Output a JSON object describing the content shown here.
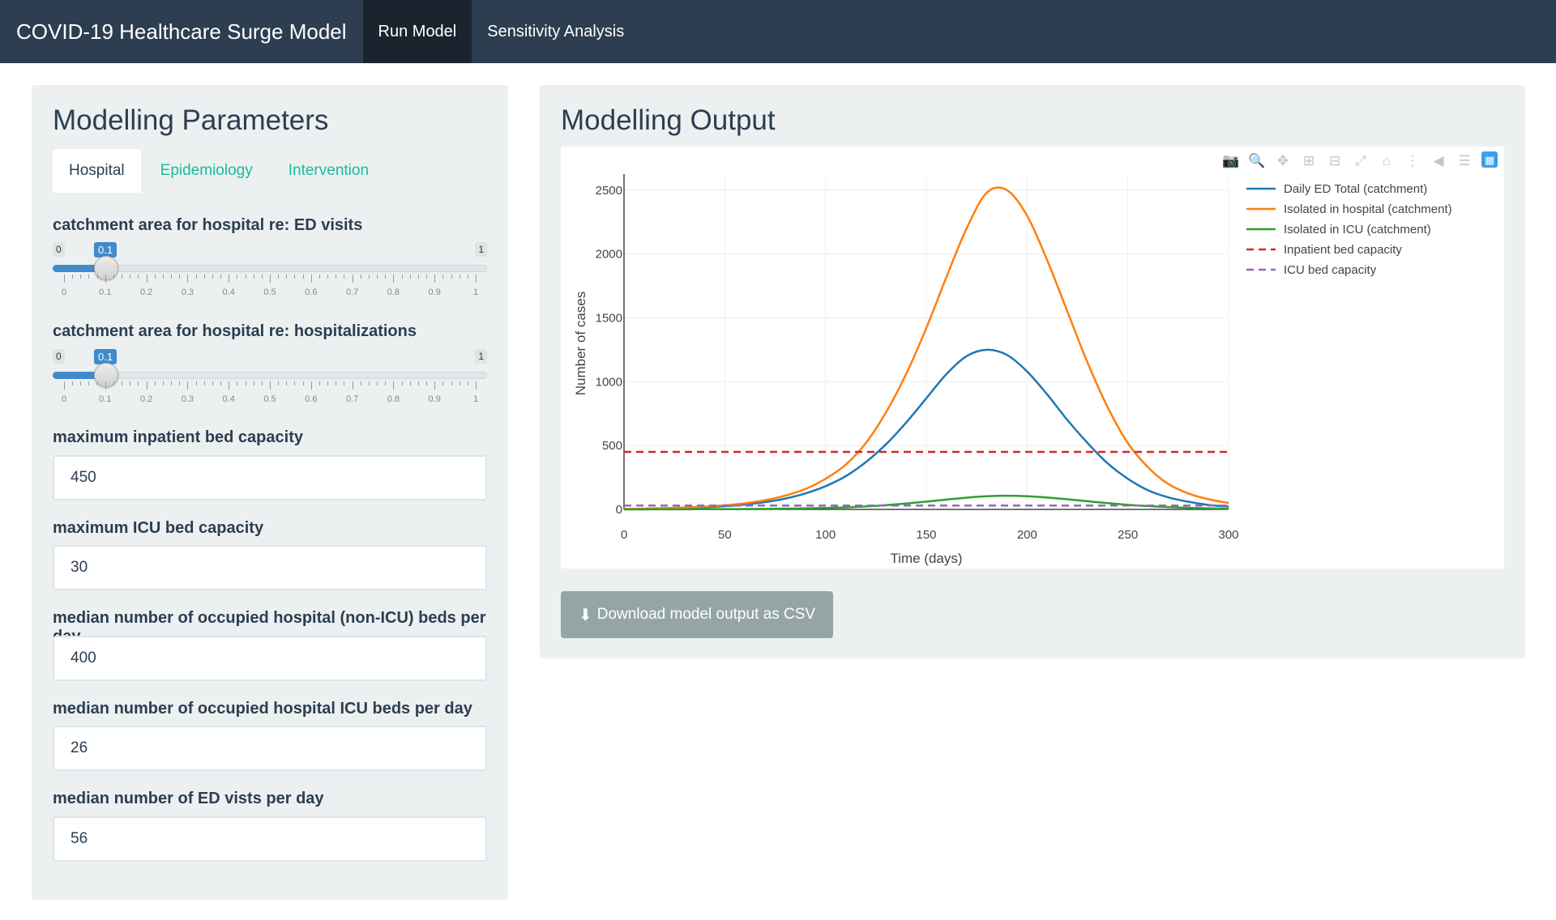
{
  "navbar": {
    "brand": "COVID-19 Healthcare Surge Model",
    "items": [
      {
        "label": "Run Model",
        "active": true
      },
      {
        "label": "Sensitivity Analysis",
        "active": false
      }
    ]
  },
  "params": {
    "title": "Modelling Parameters",
    "tabs": [
      {
        "label": "Hospital",
        "active": true
      },
      {
        "label": "Epidemiology",
        "active": false
      },
      {
        "label": "Intervention",
        "active": false
      }
    ],
    "slider1": {
      "label": "catchment area for hospital re: ED visits",
      "min": "0",
      "max": "1",
      "value": "0.1",
      "tick_labels": [
        "0",
        "0.1",
        "0.2",
        "0.3",
        "0.4",
        "0.5",
        "0.6",
        "0.7",
        "0.8",
        "0.9",
        "1"
      ]
    },
    "slider2": {
      "label": "catchment area for hospital re: hospitalizations",
      "min": "0",
      "max": "1",
      "value": "0.1",
      "tick_labels": [
        "0",
        "0.1",
        "0.2",
        "0.3",
        "0.4",
        "0.5",
        "0.6",
        "0.7",
        "0.8",
        "0.9",
        "1"
      ]
    },
    "inputs": [
      {
        "label": "maximum inpatient bed capacity",
        "value": "450"
      },
      {
        "label": "maximum ICU bed capacity",
        "value": "30"
      },
      {
        "label": "median number of occupied hospital (non-ICU) beds per day",
        "value": "400"
      },
      {
        "label": "median number of occupied hospital ICU beds per day",
        "value": "26"
      },
      {
        "label": "median number of ED vists per day",
        "value": "56"
      }
    ]
  },
  "output": {
    "title": "Modelling Output",
    "download_label": "Download model output as CSV",
    "modebar_icons": [
      "camera-icon",
      "zoom-icon",
      "pan-icon",
      "zoom-in-icon",
      "zoom-out-icon",
      "autoscale-icon",
      "reset-axes-icon",
      "spike-lines-icon",
      "hover-closest-icon",
      "hover-compare-icon",
      "plotly-logo-icon"
    ]
  },
  "chart_data": {
    "type": "line",
    "xlabel": "Time (days)",
    "ylabel": "Number of cases",
    "xlim": [
      0,
      300
    ],
    "ylim": [
      0,
      2600
    ],
    "xticks": [
      0,
      50,
      100,
      150,
      200,
      250,
      300
    ],
    "yticks": [
      0,
      500,
      1000,
      1500,
      2000,
      2500
    ],
    "grid": true,
    "legend_position": "top-right outside",
    "x": [
      0,
      10,
      20,
      30,
      40,
      50,
      60,
      70,
      80,
      90,
      100,
      110,
      120,
      130,
      140,
      150,
      160,
      170,
      180,
      190,
      200,
      210,
      220,
      230,
      240,
      250,
      260,
      270,
      280,
      290,
      300
    ],
    "series": [
      {
        "name": "Daily ED Total (catchment)",
        "color": "#1f77b4",
        "dash": "solid",
        "values": [
          2,
          4,
          7,
          11,
          17,
          25,
          38,
          57,
          85,
          125,
          182,
          260,
          370,
          510,
          680,
          870,
          1060,
          1200,
          1250,
          1210,
          1080,
          900,
          700,
          520,
          360,
          240,
          150,
          95,
          60,
          35,
          22
        ]
      },
      {
        "name": "Isolated in hospital (catchment)",
        "color": "#ff7f0e",
        "dash": "solid",
        "values": [
          3,
          6,
          10,
          15,
          22,
          32,
          48,
          72,
          108,
          160,
          240,
          350,
          520,
          760,
          1060,
          1420,
          1820,
          2200,
          2480,
          2500,
          2300,
          1950,
          1550,
          1150,
          800,
          520,
          330,
          200,
          125,
          80,
          50
        ]
      },
      {
        "name": "Isolated in ICU (catchment)",
        "color": "#2ca02c",
        "dash": "solid",
        "values": [
          0,
          0,
          1,
          1,
          2,
          2,
          3,
          4,
          6,
          8,
          11,
          16,
          23,
          33,
          46,
          61,
          77,
          92,
          103,
          107,
          103,
          93,
          79,
          64,
          49,
          36,
          26,
          18,
          12,
          8,
          5
        ]
      },
      {
        "name": "Inpatient bed capacity",
        "color": "#d62728",
        "dash": "dash",
        "values": [
          450,
          450,
          450,
          450,
          450,
          450,
          450,
          450,
          450,
          450,
          450,
          450,
          450,
          450,
          450,
          450,
          450,
          450,
          450,
          450,
          450,
          450,
          450,
          450,
          450,
          450,
          450,
          450,
          450,
          450,
          450
        ]
      },
      {
        "name": "ICU bed capacity",
        "color": "#9467bd",
        "dash": "dash",
        "values": [
          30,
          30,
          30,
          30,
          30,
          30,
          30,
          30,
          30,
          30,
          30,
          30,
          30,
          30,
          30,
          30,
          30,
          30,
          30,
          30,
          30,
          30,
          30,
          30,
          30,
          30,
          30,
          30,
          30,
          30,
          30
        ]
      }
    ]
  }
}
